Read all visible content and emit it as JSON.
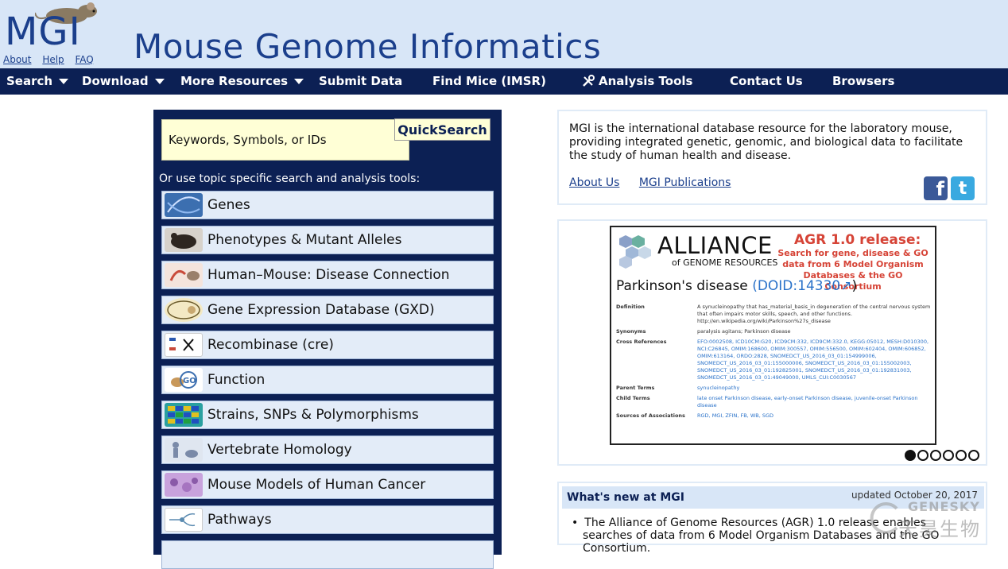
{
  "header": {
    "logo_text": "MGI",
    "links": [
      "About",
      "Help",
      "FAQ"
    ],
    "title": "Mouse Genome Informatics"
  },
  "nav": [
    {
      "label": "Search",
      "dropdown": true
    },
    {
      "label": "Download",
      "dropdown": true
    },
    {
      "label": "More Resources",
      "dropdown": true
    },
    {
      "label": "Submit Data",
      "dropdown": false
    },
    {
      "label": "Find Mice (IMSR)",
      "dropdown": false
    },
    {
      "label": "Analysis Tools",
      "dropdown": false,
      "icon": "tools-icon"
    },
    {
      "label": "Contact Us",
      "dropdown": false
    },
    {
      "label": "Browsers",
      "dropdown": false
    }
  ],
  "search": {
    "placeholder": "Keywords, Symbols, or IDs",
    "button": "QuickSearch",
    "hint": "Or use topic specific search and analysis tools:"
  },
  "topics": [
    {
      "label": "Genes",
      "icon": "dna-icon",
      "color": "#3c6fb0"
    },
    {
      "label": "Phenotypes & Mutant Alleles",
      "icon": "mouse-icon",
      "color": "#5a4a3e"
    },
    {
      "label": "Human–Mouse: Disease Connection",
      "icon": "human-mouse-icon",
      "color": "#c94a3a"
    },
    {
      "label": "Gene Expression Database (GXD)",
      "icon": "gxd-icon",
      "color": "#a08a3a"
    },
    {
      "label": "Recombinase (cre)",
      "icon": "recombinase-icon",
      "color": "#2a58b0"
    },
    {
      "label": "Function",
      "icon": "go-icon",
      "color": "#3c6fb0"
    },
    {
      "label": "Strains, SNPs & Polymorphisms",
      "icon": "snp-grid-icon",
      "color": "#2aa0a0"
    },
    {
      "label": "Vertebrate Homology",
      "icon": "homology-icon",
      "color": "#7a8aa8"
    },
    {
      "label": "Mouse Models of Human Cancer",
      "icon": "cancer-tissue-icon",
      "color": "#a674c0"
    },
    {
      "label": "Pathways",
      "icon": "pathway-icon",
      "color": "#5a8ab0"
    }
  ],
  "about": {
    "text": "MGI is the international database resource for the laboratory mouse, providing integrated genetic, genomic, and biological data to facilitate the study of human health and disease.",
    "links": [
      "About Us",
      "MGI Publications"
    ],
    "social": [
      "facebook-icon",
      "twitter-icon"
    ]
  },
  "slide": {
    "alliance_title": "ALLIANCE",
    "alliance_sub": "of GENOME RESOURCES",
    "agr_title": "AGR 1.0 release:",
    "agr_sub": "Search for gene, disease & GO data from 6 Model Organism Databases & the GO Consortium",
    "disease": "Parkinson's disease",
    "doid": "(DOID:14330",
    "doid_close": ")",
    "rows": [
      {
        "key": "Definition",
        "value": "A synucleinopathy that has_material_basis_in degeneration of the central nervous system that often impairs motor skills, speech, and other functions. http://en.wikipedia.org/wiki/Parkinson%27s_disease"
      },
      {
        "key": "Synonyms",
        "value": "paralysis agitans; Parkinson disease"
      },
      {
        "key": "Cross References",
        "value": "EFO:0002508, ICD10CM:G20, ICD9CM:332, ICD9CM:332.0, KEGG:05012, MESH:D010300, NCI:C26845, OMIM:168600, OMIM:300557, OMIM:556500, OMIM:602404, OMIM:606852, OMIM:613164, ORDO:2828, SNOMEDCT_US_2016_03_01:154999006, SNOMEDCT_US_2016_03_01:155000006, SNOMEDCT_US_2016_03_01:155002003, SNOMEDCT_US_2016_03_01:192825001, SNOMEDCT_US_2016_03_01:192831003, SNOMEDCT_US_2016_03_01:49049000, UMLS_CUI:C0030567"
      },
      {
        "key": "Parent Terms",
        "value": "synucleinopathy"
      },
      {
        "key": "Child Terms",
        "value": "late onset Parkinson disease, early-onset Parkinson disease, juvenile-onset Parkinson disease"
      },
      {
        "key": "Sources of Associations",
        "value": "RGD, MGI, ZFIN, FB, WB, SGD"
      }
    ],
    "dots_total": 6,
    "dots_active": 0
  },
  "whats_new": {
    "title": "What's new at MGI",
    "updated": "updated October 20, 2017",
    "item": "The Alliance of Genome Resources (AGR) 1.0 release enables searches of data from 6 Model Organism Databases and the GO Consortium."
  },
  "watermark": {
    "en": "GENESKY",
    "cn": "天昊生物"
  }
}
